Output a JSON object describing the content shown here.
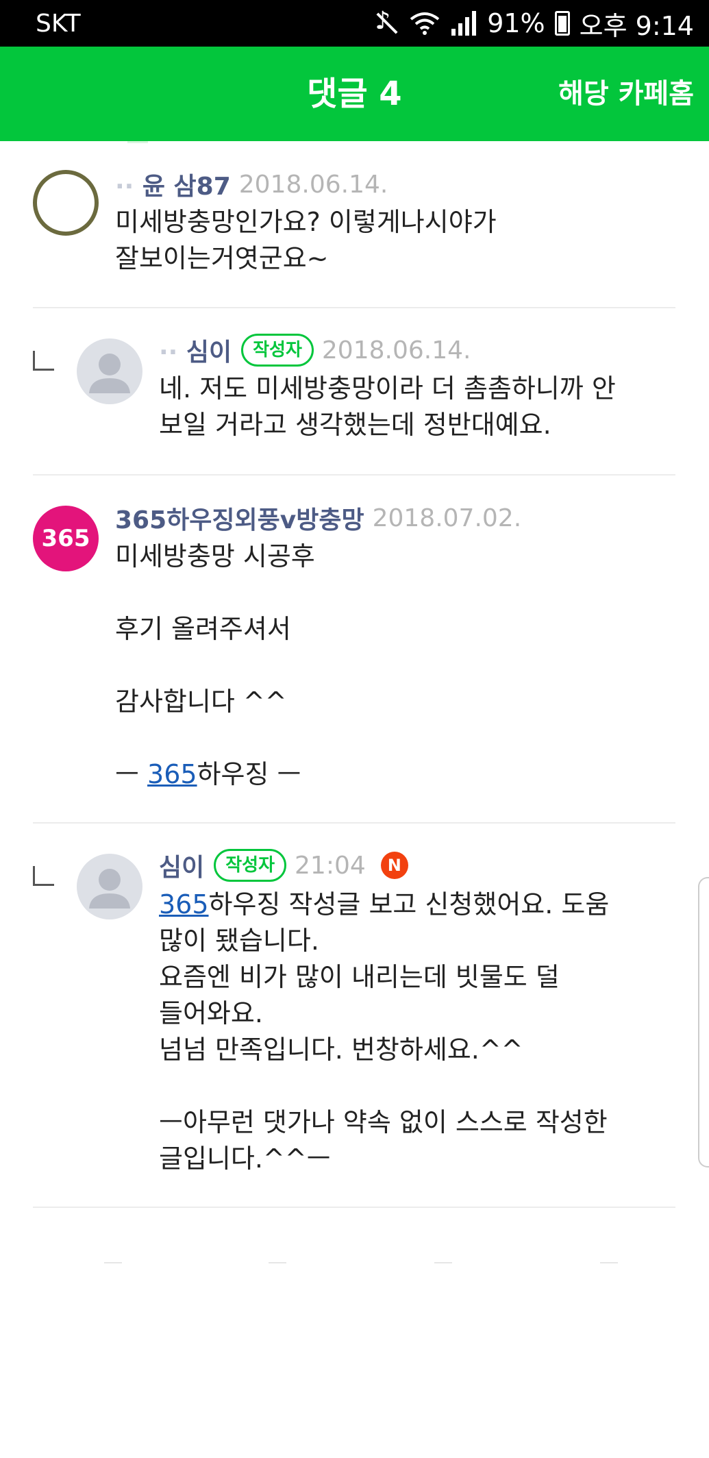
{
  "status_bar": {
    "carrier": "SKT",
    "battery": "91%",
    "time": "오후 9:14"
  },
  "header": {
    "title": "댓글 4",
    "cafe_home": "해당 카페홈"
  },
  "comments": [
    {
      "author_faint": "·· ",
      "author": "윤    삼87",
      "date": "2018.06.14.",
      "lines": [
        "미세방충망인가요? 이렇게나시야가",
        "잘보이는거엿군요~"
      ]
    },
    {
      "author_faint": "·· ",
      "author": "심이",
      "badge": "작성자",
      "date": "2018.06.14.",
      "lines": [
        "네. 저도 미세방충망이라 더 촘촘하니까 안",
        "보일 거라고 생각했는데 정반대예요."
      ]
    },
    {
      "avatar_text": "365",
      "author": "365하우징외풍v방충망",
      "date": "2018.07.02.",
      "lines": [
        "미세방충망 시공후",
        "",
        "후기 올려주셔서",
        "",
        "감사합니다 ^^",
        ""
      ],
      "signature_prefix": "ㅡ ",
      "signature_link": "365",
      "signature_suffix": "하우징 ㅡ"
    },
    {
      "author_faint": "   ",
      "author": "심이",
      "badge": "작성자",
      "date": "21:04",
      "new_badge": "N",
      "first_link": "365",
      "first_suffix": "하우징 작성글 보고 신청했어요. 도움",
      "lines": [
        "많이 됐습니다.",
        "요즘엔 비가 많이 내리는데 빗물도 덜",
        "들어와요.",
        "넘넘 만족입니다. 번창하세요.^^",
        "",
        "ㅡ아무런 댓가나 약속 없이 스스로 작성한",
        "글입니다.^^ㅡ"
      ]
    }
  ],
  "colors": {
    "header_green": "#03c63c",
    "author_blue": "#4d5b85",
    "brand_pink": "#e3147b",
    "new_red": "#f2410f",
    "link_blue": "#1a5db8"
  }
}
